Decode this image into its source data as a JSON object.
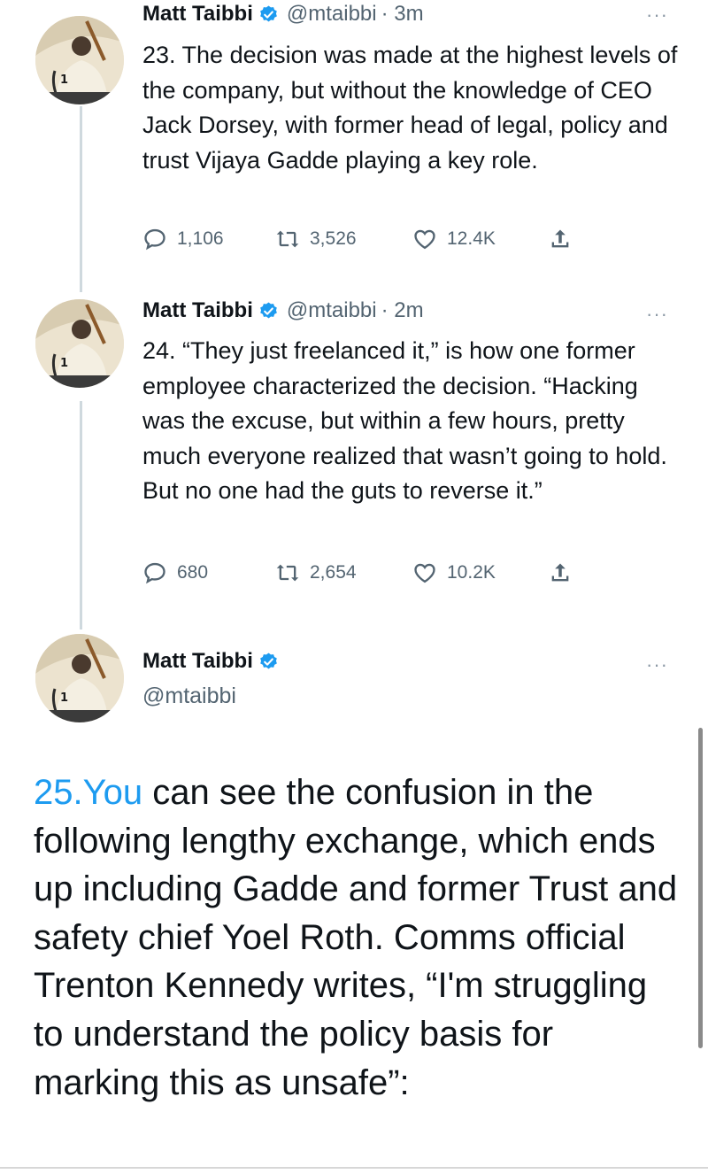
{
  "tweets": [
    {
      "name": "Matt Taibbi",
      "handle": "@mtaibbi",
      "time": "· 3m",
      "more": "···",
      "text": "23. The decision was made at the highest levels of the company, but without the knowledge of CEO Jack Dorsey, with former head of legal, policy and trust Vijaya Gadde playing a key role.",
      "replies": "1,106",
      "retweets": "3,526",
      "likes": "12.4K"
    },
    {
      "name": "Matt Taibbi",
      "handle": "@mtaibbi",
      "time": "· 2m",
      "more": "···",
      "text": "24. “They just freelanced it,” is how one former employee characterized the decision. “Hacking was the excuse, but within a few hours, pretty much everyone realized that wasn’t going to hold. But no one had the guts to reverse it.”",
      "replies": "680",
      "retweets": "2,654",
      "likes": "10.2K"
    }
  ],
  "focused": {
    "name": "Matt Taibbi",
    "handle": "@mtaibbi",
    "more": "···",
    "link_text": "25.You",
    "text": " can see the confusion in the following lengthy exchange, which ends up including Gadde and former Trust and safety chief Yoel Roth. Comms official Trenton Kennedy writes, “I'm struggling to understand the policy basis for marking this as unsafe”:"
  },
  "colors": {
    "link": "#1d9bf0",
    "verified": "#1d9bf0",
    "secondary_text": "#536471"
  },
  "icons": [
    "reply-icon",
    "retweet-icon",
    "like-icon",
    "share-icon",
    "verified-badge-icon",
    "more-options-icon"
  ]
}
